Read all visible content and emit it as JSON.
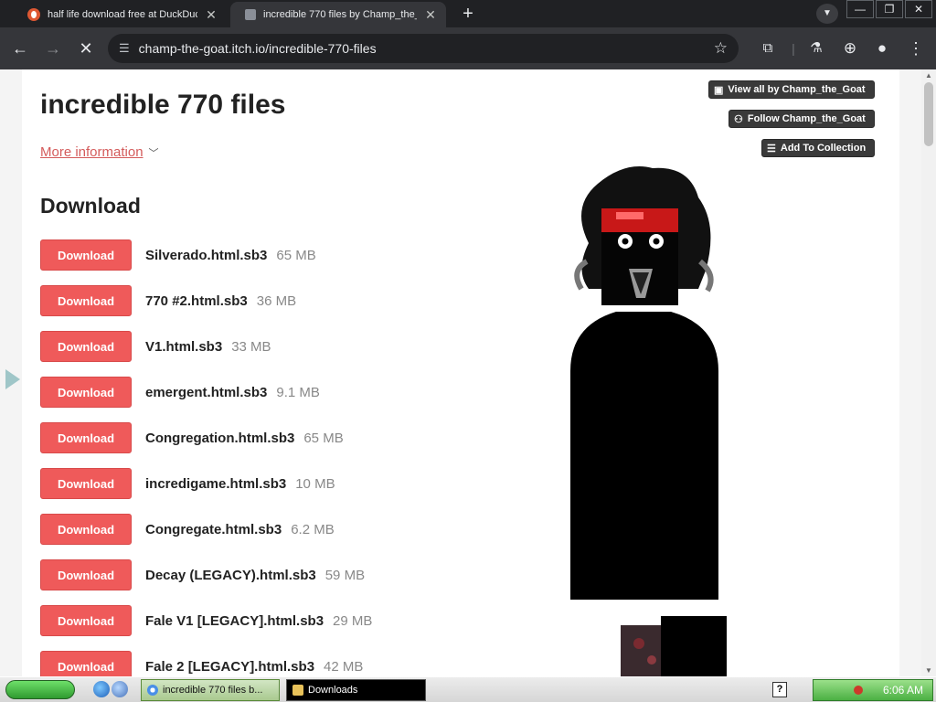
{
  "browser": {
    "tabs": [
      {
        "title": "half life download free at DuckDuc"
      },
      {
        "title": "incredible 770 files by Champ_the_"
      }
    ],
    "new_tab": "+",
    "url": "champ-the-goat.itch.io/incredible-770-files"
  },
  "page": {
    "title": "incredible 770 files",
    "more_info": "More information",
    "download_heading": "Download",
    "download_label": "Download",
    "files": [
      {
        "name": "Silverado.html.sb3",
        "size": "65 MB"
      },
      {
        "name": "770 #2.html.sb3",
        "size": "36 MB"
      },
      {
        "name": "V1.html.sb3",
        "size": "33 MB"
      },
      {
        "name": "emergent.html.sb3",
        "size": "9.1 MB"
      },
      {
        "name": "Congregation.html.sb3",
        "size": "65 MB"
      },
      {
        "name": "incredigame.html.sb3",
        "size": "10 MB"
      },
      {
        "name": "Congregate.html.sb3",
        "size": "6.2 MB"
      },
      {
        "name": "Decay (LEGACY).html.sb3",
        "size": "59 MB"
      },
      {
        "name": "Fale V1 [LEGACY].html.sb3",
        "size": "29 MB"
      },
      {
        "name": "Fale 2 [LEGACY].html.sb3",
        "size": "42 MB"
      }
    ],
    "side_buttons": {
      "view_all": "View all by Champ_the_Goat",
      "follow": "Follow Champ_the_Goat",
      "collection": "Add To Collection"
    }
  },
  "taskbar": {
    "tasks": [
      {
        "label": "incredible 770 files b..."
      },
      {
        "label": "Downloads"
      }
    ],
    "clock": "6:06 AM"
  },
  "colors": {
    "download_button": "#ef5a5a",
    "link": "#d45b5b",
    "chrome_bg": "#35363a",
    "tabstrip_bg": "#202124"
  }
}
